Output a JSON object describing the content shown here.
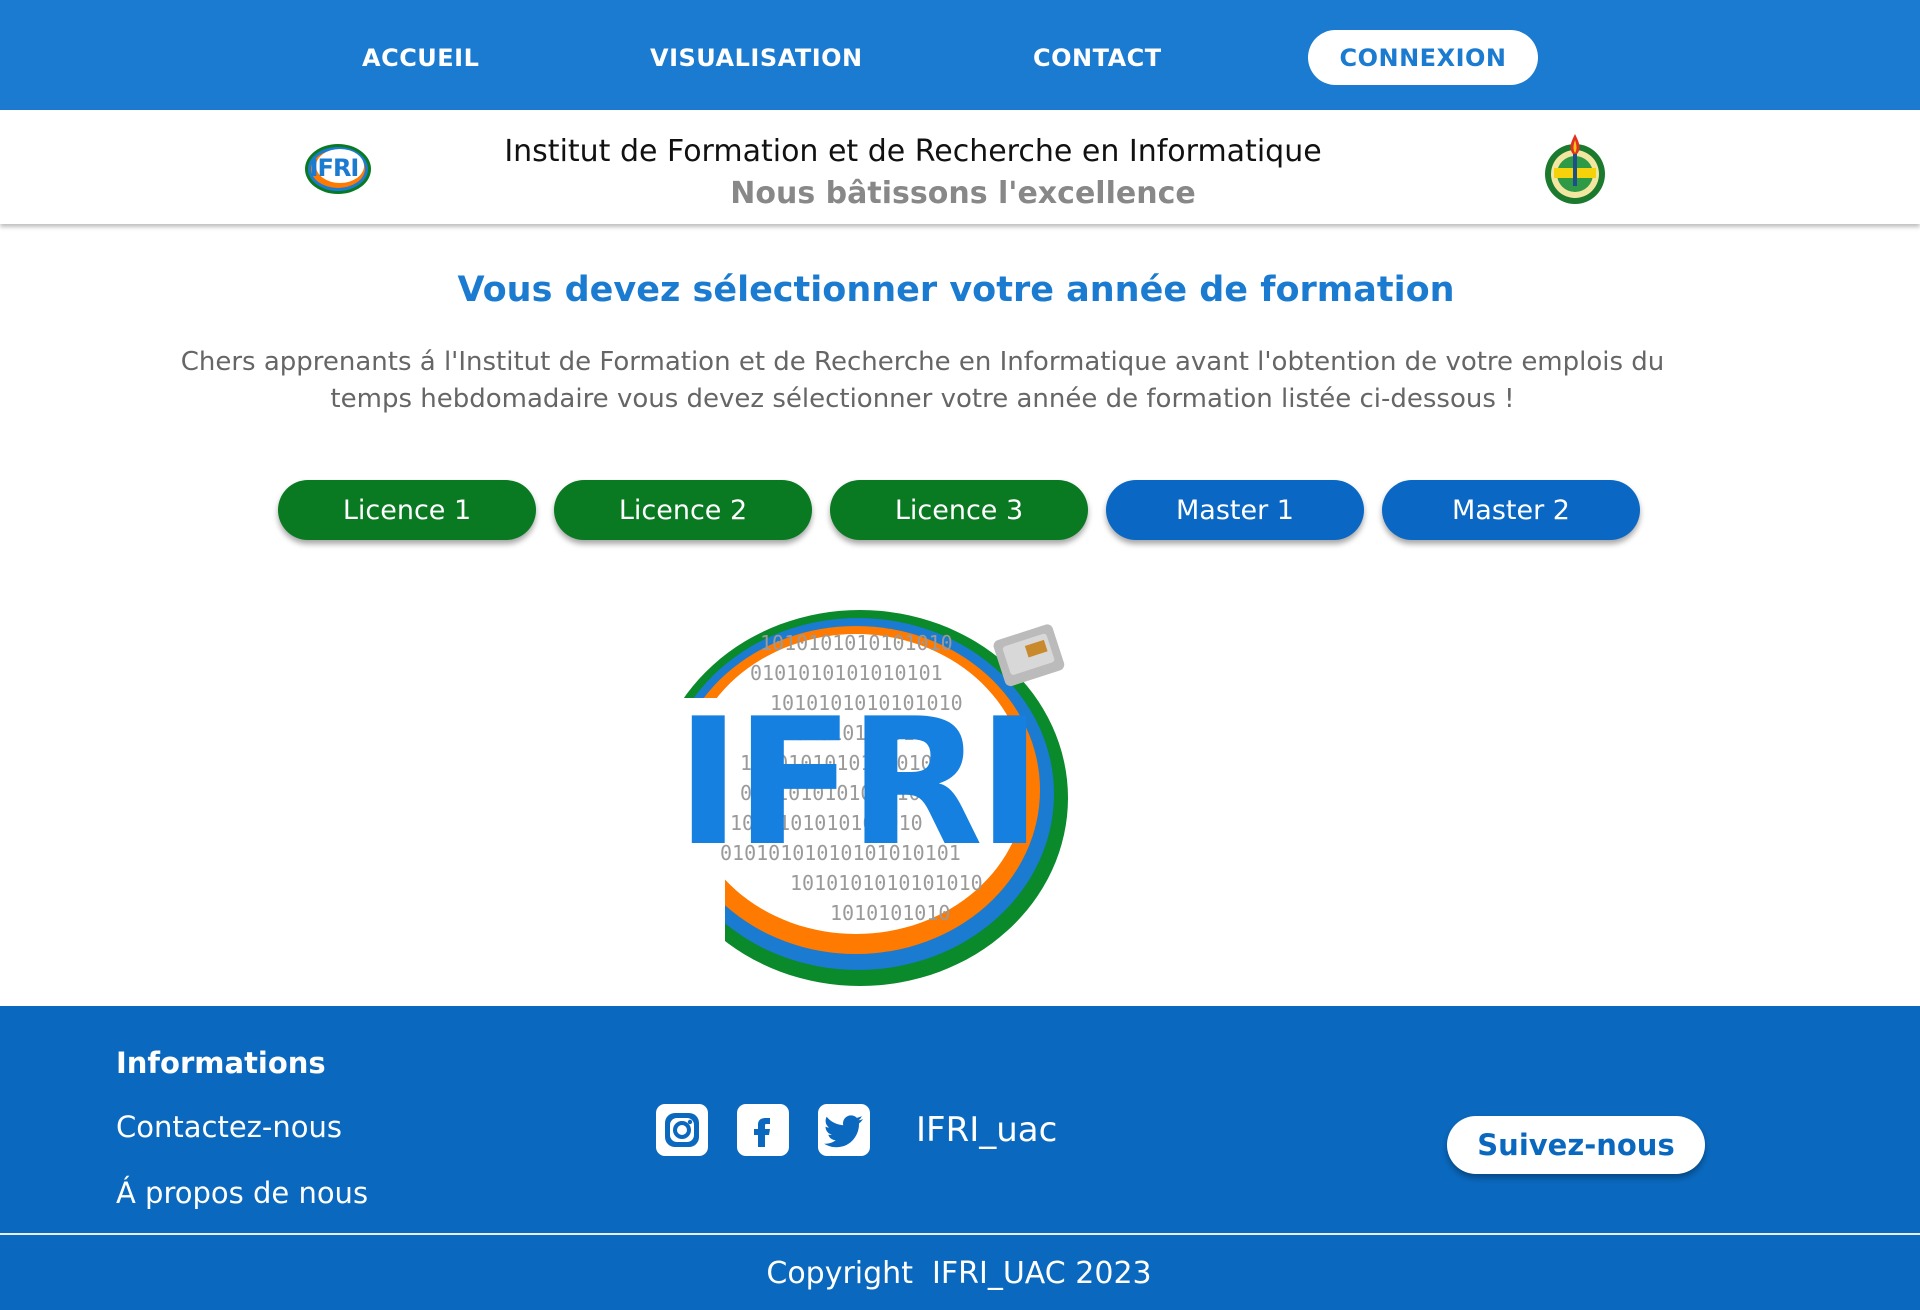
{
  "nav": {
    "home": "ACCUEIL",
    "visualisation": "VISUALISATION",
    "contact": "CONTACT",
    "login": "CONNEXION"
  },
  "header": {
    "institute_name": "Institut de Formation et de Recherche en Informatique",
    "motto": "Nous bâtissons l'excellence",
    "logo_text": "IFRI"
  },
  "main": {
    "title": "Vous devez sélectionner votre année de formation",
    "intro": "Chers apprenants á l'Institut de Formation et de Recherche en Informatique avant l'obtention de votre emplois du temps hebdomadaire vous devez sélectionner votre année de formation listée ci-dessous !",
    "years": [
      {
        "label": "Licence 1",
        "color": "#0a7a22"
      },
      {
        "label": "Licence 2",
        "color": "#0a7a22"
      },
      {
        "label": "Licence 3",
        "color": "#0a7a22"
      },
      {
        "label": "Master 1",
        "color": "#0a68c4"
      },
      {
        "label": "Master 2",
        "color": "#0a68c4"
      }
    ],
    "logo_text": "IFRI"
  },
  "footer": {
    "heading": "Informations",
    "contact_link": "Contactez-nous",
    "about_link": "Á propos de nous",
    "social_icons": [
      "instagram-icon",
      "facebook-icon",
      "twitter-icon"
    ],
    "handle": "IFRI_uac",
    "follow_button": "Suivez-nous",
    "copyright": "Copyright  IFRI_UAC 2023"
  },
  "colors": {
    "primary_blue": "#1a7bd0",
    "footer_blue": "#0a68be",
    "green": "#0a7a22",
    "orange": "#ff7a00"
  }
}
